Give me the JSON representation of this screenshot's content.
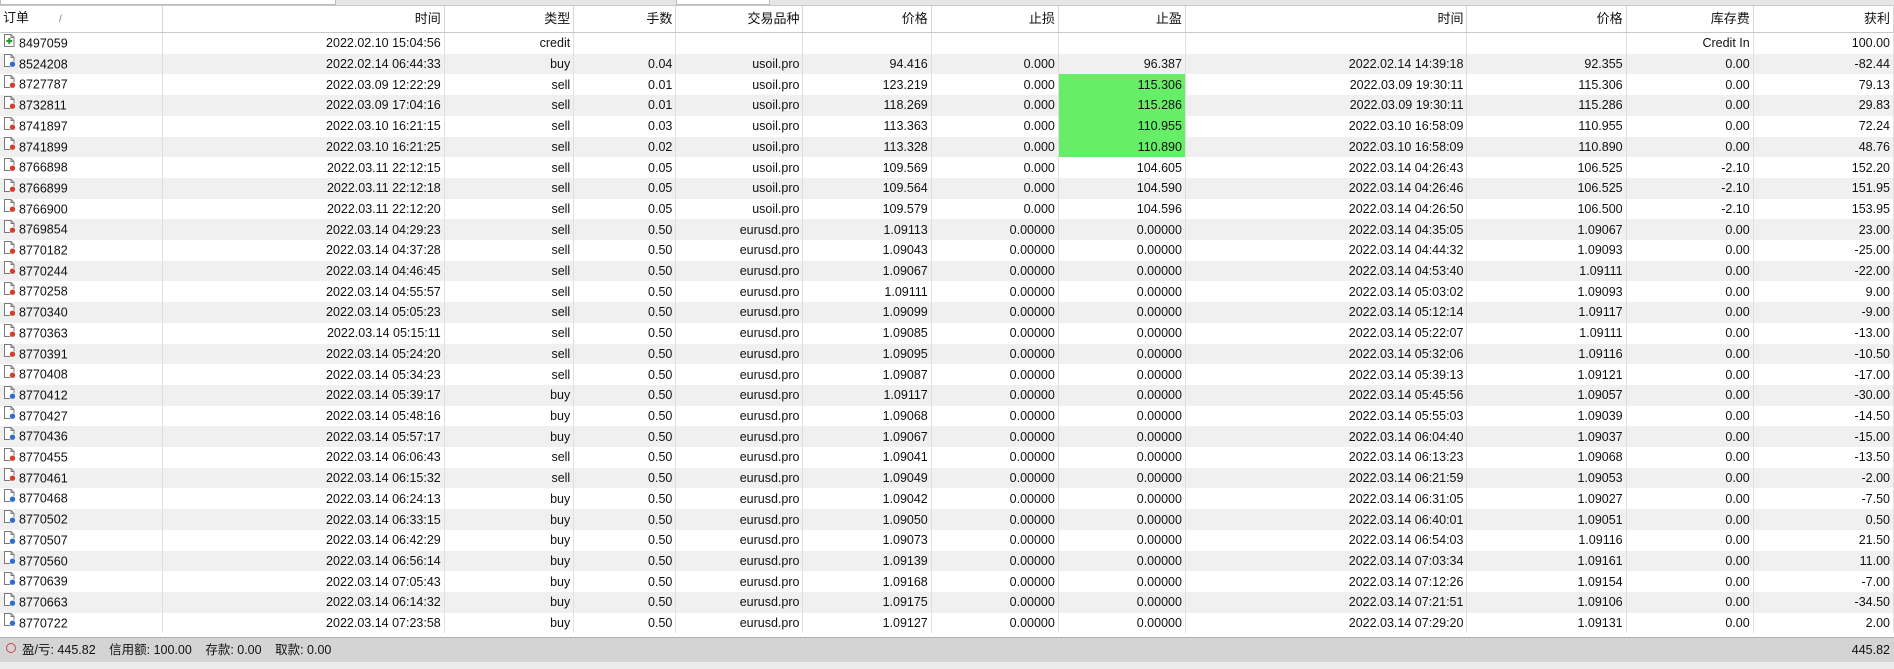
{
  "headers": {
    "order": "订单",
    "open_time": "时间",
    "type": "类型",
    "lots": "手数",
    "symbol": "交易品种",
    "open_price": "价格",
    "sl": "止损",
    "tp": "止盈",
    "close_time": "时间",
    "close_price": "价格",
    "swap": "库存费",
    "profit": "获利"
  },
  "sort_indicator": "/",
  "rows": [
    {
      "order": "8497059",
      "open_time": "2022.02.10 15:04:56",
      "type": "credit",
      "lots": "",
      "symbol": "",
      "open_price": "",
      "sl": "",
      "tp": "",
      "close_time": "",
      "close_price": "",
      "swap": "Credit In",
      "profit": "100.00",
      "icon": "credit",
      "tp_hit": false
    },
    {
      "order": "8524208",
      "open_time": "2022.02.14 06:44:33",
      "type": "buy",
      "lots": "0.04",
      "symbol": "usoil.pro",
      "open_price": "94.416",
      "sl": "0.000",
      "tp": "96.387",
      "close_time": "2022.02.14 14:39:18",
      "close_price": "92.355",
      "swap": "0.00",
      "profit": "-82.44",
      "icon": "buy",
      "tp_hit": false
    },
    {
      "order": "8727787",
      "open_time": "2022.03.09 12:22:29",
      "type": "sell",
      "lots": "0.01",
      "symbol": "usoil.pro",
      "open_price": "123.219",
      "sl": "0.000",
      "tp": "115.306",
      "close_time": "2022.03.09 19:30:11",
      "close_price": "115.306",
      "swap": "0.00",
      "profit": "79.13",
      "icon": "sell",
      "tp_hit": true
    },
    {
      "order": "8732811",
      "open_time": "2022.03.09 17:04:16",
      "type": "sell",
      "lots": "0.01",
      "symbol": "usoil.pro",
      "open_price": "118.269",
      "sl": "0.000",
      "tp": "115.286",
      "close_time": "2022.03.09 19:30:11",
      "close_price": "115.286",
      "swap": "0.00",
      "profit": "29.83",
      "icon": "sell",
      "tp_hit": true
    },
    {
      "order": "8741897",
      "open_time": "2022.03.10 16:21:15",
      "type": "sell",
      "lots": "0.03",
      "symbol": "usoil.pro",
      "open_price": "113.363",
      "sl": "0.000",
      "tp": "110.955",
      "close_time": "2022.03.10 16:58:09",
      "close_price": "110.955",
      "swap": "0.00",
      "profit": "72.24",
      "icon": "sell",
      "tp_hit": true
    },
    {
      "order": "8741899",
      "open_time": "2022.03.10 16:21:25",
      "type": "sell",
      "lots": "0.02",
      "symbol": "usoil.pro",
      "open_price": "113.328",
      "sl": "0.000",
      "tp": "110.890",
      "close_time": "2022.03.10 16:58:09",
      "close_price": "110.890",
      "swap": "0.00",
      "profit": "48.76",
      "icon": "sell",
      "tp_hit": true
    },
    {
      "order": "8766898",
      "open_time": "2022.03.11 22:12:15",
      "type": "sell",
      "lots": "0.05",
      "symbol": "usoil.pro",
      "open_price": "109.569",
      "sl": "0.000",
      "tp": "104.605",
      "close_time": "2022.03.14 04:26:43",
      "close_price": "106.525",
      "swap": "-2.10",
      "profit": "152.20",
      "icon": "sell",
      "tp_hit": false
    },
    {
      "order": "8766899",
      "open_time": "2022.03.11 22:12:18",
      "type": "sell",
      "lots": "0.05",
      "symbol": "usoil.pro",
      "open_price": "109.564",
      "sl": "0.000",
      "tp": "104.590",
      "close_time": "2022.03.14 04:26:46",
      "close_price": "106.525",
      "swap": "-2.10",
      "profit": "151.95",
      "icon": "sell",
      "tp_hit": false
    },
    {
      "order": "8766900",
      "open_time": "2022.03.11 22:12:20",
      "type": "sell",
      "lots": "0.05",
      "symbol": "usoil.pro",
      "open_price": "109.579",
      "sl": "0.000",
      "tp": "104.596",
      "close_time": "2022.03.14 04:26:50",
      "close_price": "106.500",
      "swap": "-2.10",
      "profit": "153.95",
      "icon": "sell",
      "tp_hit": false
    },
    {
      "order": "8769854",
      "open_time": "2022.03.14 04:29:23",
      "type": "sell",
      "lots": "0.50",
      "symbol": "eurusd.pro",
      "open_price": "1.09113",
      "sl": "0.00000",
      "tp": "0.00000",
      "close_time": "2022.03.14 04:35:05",
      "close_price": "1.09067",
      "swap": "0.00",
      "profit": "23.00",
      "icon": "sell",
      "tp_hit": false
    },
    {
      "order": "8770182",
      "open_time": "2022.03.14 04:37:28",
      "type": "sell",
      "lots": "0.50",
      "symbol": "eurusd.pro",
      "open_price": "1.09043",
      "sl": "0.00000",
      "tp": "0.00000",
      "close_time": "2022.03.14 04:44:32",
      "close_price": "1.09093",
      "swap": "0.00",
      "profit": "-25.00",
      "icon": "sell",
      "tp_hit": false
    },
    {
      "order": "8770244",
      "open_time": "2022.03.14 04:46:45",
      "type": "sell",
      "lots": "0.50",
      "symbol": "eurusd.pro",
      "open_price": "1.09067",
      "sl": "0.00000",
      "tp": "0.00000",
      "close_time": "2022.03.14 04:53:40",
      "close_price": "1.09111",
      "swap": "0.00",
      "profit": "-22.00",
      "icon": "sell",
      "tp_hit": false
    },
    {
      "order": "8770258",
      "open_time": "2022.03.14 04:55:57",
      "type": "sell",
      "lots": "0.50",
      "symbol": "eurusd.pro",
      "open_price": "1.09111",
      "sl": "0.00000",
      "tp": "0.00000",
      "close_time": "2022.03.14 05:03:02",
      "close_price": "1.09093",
      "swap": "0.00",
      "profit": "9.00",
      "icon": "sell",
      "tp_hit": false
    },
    {
      "order": "8770340",
      "open_time": "2022.03.14 05:05:23",
      "type": "sell",
      "lots": "0.50",
      "symbol": "eurusd.pro",
      "open_price": "1.09099",
      "sl": "0.00000",
      "tp": "0.00000",
      "close_time": "2022.03.14 05:12:14",
      "close_price": "1.09117",
      "swap": "0.00",
      "profit": "-9.00",
      "icon": "sell",
      "tp_hit": false
    },
    {
      "order": "8770363",
      "open_time": "2022.03.14 05:15:11",
      "type": "sell",
      "lots": "0.50",
      "symbol": "eurusd.pro",
      "open_price": "1.09085",
      "sl": "0.00000",
      "tp": "0.00000",
      "close_time": "2022.03.14 05:22:07",
      "close_price": "1.09111",
      "swap": "0.00",
      "profit": "-13.00",
      "icon": "sell",
      "tp_hit": false
    },
    {
      "order": "8770391",
      "open_time": "2022.03.14 05:24:20",
      "type": "sell",
      "lots": "0.50",
      "symbol": "eurusd.pro",
      "open_price": "1.09095",
      "sl": "0.00000",
      "tp": "0.00000",
      "close_time": "2022.03.14 05:32:06",
      "close_price": "1.09116",
      "swap": "0.00",
      "profit": "-10.50",
      "icon": "sell",
      "tp_hit": false
    },
    {
      "order": "8770408",
      "open_time": "2022.03.14 05:34:23",
      "type": "sell",
      "lots": "0.50",
      "symbol": "eurusd.pro",
      "open_price": "1.09087",
      "sl": "0.00000",
      "tp": "0.00000",
      "close_time": "2022.03.14 05:39:13",
      "close_price": "1.09121",
      "swap": "0.00",
      "profit": "-17.00",
      "icon": "sell",
      "tp_hit": false
    },
    {
      "order": "8770412",
      "open_time": "2022.03.14 05:39:17",
      "type": "buy",
      "lots": "0.50",
      "symbol": "eurusd.pro",
      "open_price": "1.09117",
      "sl": "0.00000",
      "tp": "0.00000",
      "close_time": "2022.03.14 05:45:56",
      "close_price": "1.09057",
      "swap": "0.00",
      "profit": "-30.00",
      "icon": "buy",
      "tp_hit": false
    },
    {
      "order": "8770427",
      "open_time": "2022.03.14 05:48:16",
      "type": "buy",
      "lots": "0.50",
      "symbol": "eurusd.pro",
      "open_price": "1.09068",
      "sl": "0.00000",
      "tp": "0.00000",
      "close_time": "2022.03.14 05:55:03",
      "close_price": "1.09039",
      "swap": "0.00",
      "profit": "-14.50",
      "icon": "buy",
      "tp_hit": false
    },
    {
      "order": "8770436",
      "open_time": "2022.03.14 05:57:17",
      "type": "buy",
      "lots": "0.50",
      "symbol": "eurusd.pro",
      "open_price": "1.09067",
      "sl": "0.00000",
      "tp": "0.00000",
      "close_time": "2022.03.14 06:04:40",
      "close_price": "1.09037",
      "swap": "0.00",
      "profit": "-15.00",
      "icon": "buy",
      "tp_hit": false
    },
    {
      "order": "8770455",
      "open_time": "2022.03.14 06:06:43",
      "type": "sell",
      "lots": "0.50",
      "symbol": "eurusd.pro",
      "open_price": "1.09041",
      "sl": "0.00000",
      "tp": "0.00000",
      "close_time": "2022.03.14 06:13:23",
      "close_price": "1.09068",
      "swap": "0.00",
      "profit": "-13.50",
      "icon": "sell",
      "tp_hit": false
    },
    {
      "order": "8770461",
      "open_time": "2022.03.14 06:15:32",
      "type": "sell",
      "lots": "0.50",
      "symbol": "eurusd.pro",
      "open_price": "1.09049",
      "sl": "0.00000",
      "tp": "0.00000",
      "close_time": "2022.03.14 06:21:59",
      "close_price": "1.09053",
      "swap": "0.00",
      "profit": "-2.00",
      "icon": "sell",
      "tp_hit": false
    },
    {
      "order": "8770468",
      "open_time": "2022.03.14 06:24:13",
      "type": "buy",
      "lots": "0.50",
      "symbol": "eurusd.pro",
      "open_price": "1.09042",
      "sl": "0.00000",
      "tp": "0.00000",
      "close_time": "2022.03.14 06:31:05",
      "close_price": "1.09027",
      "swap": "0.00",
      "profit": "-7.50",
      "icon": "buy",
      "tp_hit": false
    },
    {
      "order": "8770502",
      "open_time": "2022.03.14 06:33:15",
      "type": "buy",
      "lots": "0.50",
      "symbol": "eurusd.pro",
      "open_price": "1.09050",
      "sl": "0.00000",
      "tp": "0.00000",
      "close_time": "2022.03.14 06:40:01",
      "close_price": "1.09051",
      "swap": "0.00",
      "profit": "0.50",
      "icon": "buy",
      "tp_hit": false
    },
    {
      "order": "8770507",
      "open_time": "2022.03.14 06:42:29",
      "type": "buy",
      "lots": "0.50",
      "symbol": "eurusd.pro",
      "open_price": "1.09073",
      "sl": "0.00000",
      "tp": "0.00000",
      "close_time": "2022.03.14 06:54:03",
      "close_price": "1.09116",
      "swap": "0.00",
      "profit": "21.50",
      "icon": "buy",
      "tp_hit": false
    },
    {
      "order": "8770560",
      "open_time": "2022.03.14 06:56:14",
      "type": "buy",
      "lots": "0.50",
      "symbol": "eurusd.pro",
      "open_price": "1.09139",
      "sl": "0.00000",
      "tp": "0.00000",
      "close_time": "2022.03.14 07:03:34",
      "close_price": "1.09161",
      "swap": "0.00",
      "profit": "11.00",
      "icon": "buy",
      "tp_hit": false
    },
    {
      "order": "8770639",
      "open_time": "2022.03.14 07:05:43",
      "type": "buy",
      "lots": "0.50",
      "symbol": "eurusd.pro",
      "open_price": "1.09168",
      "sl": "0.00000",
      "tp": "0.00000",
      "close_time": "2022.03.14 07:12:26",
      "close_price": "1.09154",
      "swap": "0.00",
      "profit": "-7.00",
      "icon": "buy",
      "tp_hit": false
    },
    {
      "order": "8770663",
      "open_time": "2022.03.14 06:14:32",
      "type": "buy",
      "lots": "0.50",
      "symbol": "eurusd.pro",
      "open_price": "1.09175",
      "sl": "0.00000",
      "tp": "0.00000",
      "close_time": "2022.03.14 07:21:51",
      "close_price": "1.09106",
      "swap": "0.00",
      "profit": "-34.50",
      "icon": "buy",
      "tp_hit": false
    },
    {
      "order": "8770722",
      "open_time": "2022.03.14 07:23:58",
      "type": "buy",
      "lots": "0.50",
      "symbol": "eurusd.pro",
      "open_price": "1.09127",
      "sl": "0.00000",
      "tp": "0.00000",
      "close_time": "2022.03.14 07:29:20",
      "close_price": "1.09131",
      "swap": "0.00",
      "profit": "2.00",
      "icon": "buy",
      "tp_hit": false
    }
  ],
  "status_bar": {
    "summary_items": [
      "盈/亏: 445.82",
      "信用额: 100.00",
      "存款: 0.00",
      "取款: 0.00"
    ],
    "total": "445.82"
  },
  "colors": {
    "tp_highlight": "#66ee66",
    "row_alt": "#f0f0f0",
    "status_bg": "#d4d4d4",
    "buy_icon_dot": "#2f6fd0",
    "sell_icon_dot": "#d2402a",
    "credit_icon_mark": "#2a9a2a"
  },
  "icons": {
    "buy": "buy-order-icon",
    "sell": "sell-order-icon",
    "credit": "credit-order-icon",
    "status": "balance-indicator-icon"
  }
}
